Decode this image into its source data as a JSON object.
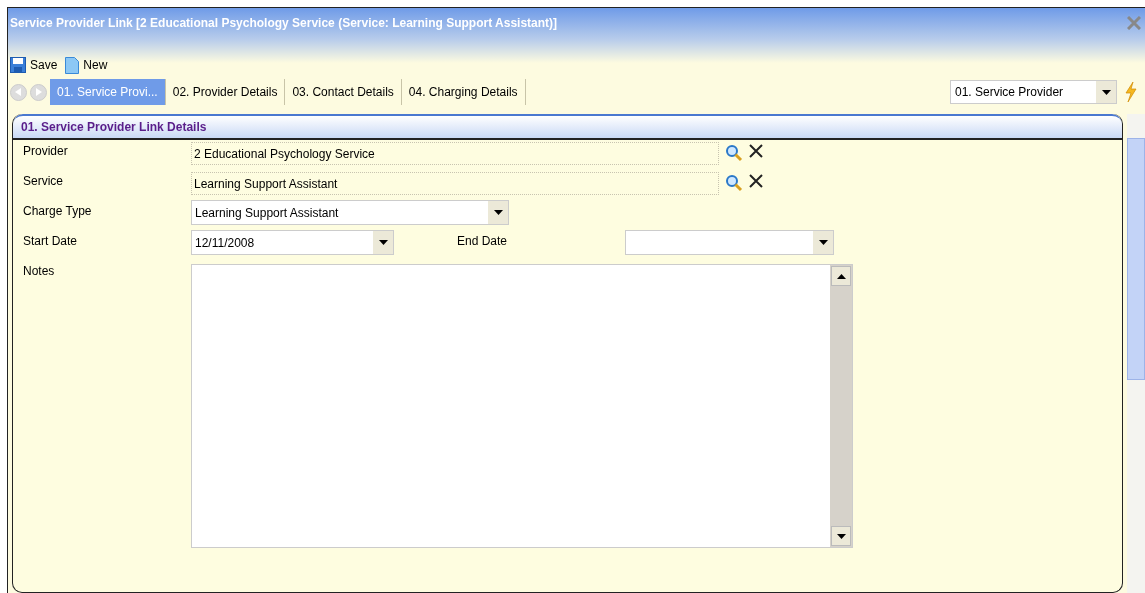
{
  "window": {
    "title": "Service Provider Link [2 Educational Psychology Service (Service: Learning Support Assistant)]"
  },
  "toolbar": [
    {
      "kind": "save",
      "label": "Save"
    },
    {
      "kind": "new",
      "label": "New"
    }
  ],
  "tabs": [
    {
      "label": "01. Service Provi...",
      "selected": true
    },
    {
      "label": "02. Provider Details",
      "selected": false
    },
    {
      "label": "03. Contact Details",
      "selected": false
    },
    {
      "label": "04. Charging Details",
      "selected": false
    }
  ],
  "section_select": {
    "value": "01. Service Provider"
  },
  "panel": {
    "title": "01. Service Provider Link Details",
    "fields": [
      {
        "kind": "lookup",
        "label": "Provider",
        "value": "2 Educational  Psychology Service"
      },
      {
        "kind": "lookup",
        "label": "Service",
        "value": "Learning Support Assistant"
      },
      {
        "kind": "dropdown",
        "label": "Charge Type",
        "value": "Learning Support Assistant"
      },
      {
        "kind": "dates",
        "label": "Start Date",
        "value": "12/11/2008",
        "label_2": "End Date"
      },
      {
        "kind": "memo",
        "label": "Notes"
      }
    ]
  }
}
